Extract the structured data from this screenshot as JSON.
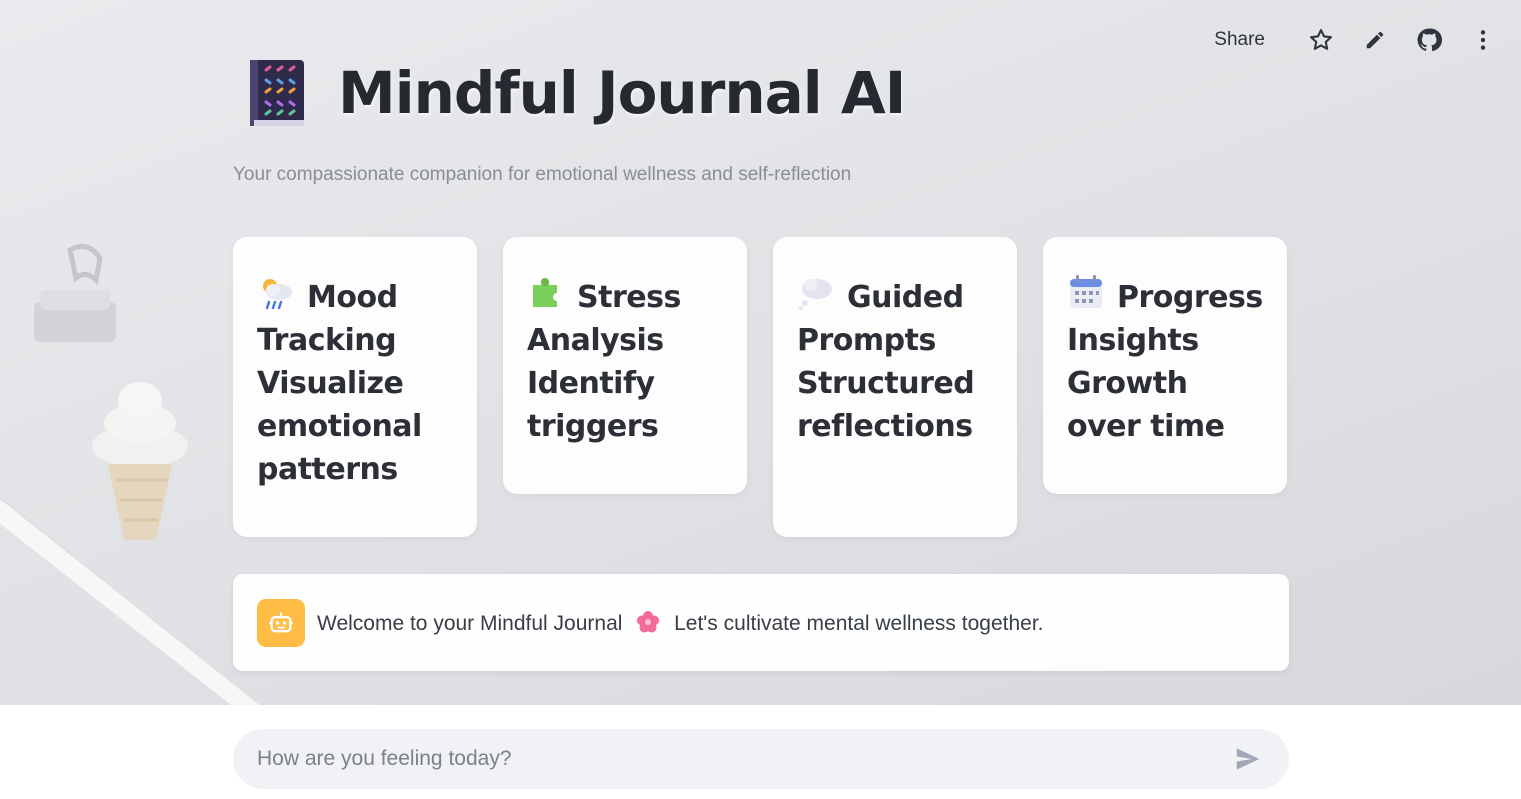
{
  "toolbar": {
    "share_label": "Share",
    "icons": [
      "star-icon",
      "pencil-icon",
      "github-icon",
      "more-vertical-icon"
    ]
  },
  "header": {
    "title": "Mindful Journal AI",
    "title_icon": "notebook-icon",
    "subtitle": "Your compassionate companion for emotional wellness and self-reflection"
  },
  "features": [
    {
      "icon": "rain-cloud-icon",
      "text": "Mood Tracking Visualize emotional patterns"
    },
    {
      "icon": "puzzle-piece-icon",
      "text": "Stress Analysis Identify triggers"
    },
    {
      "icon": "thought-bubble-icon",
      "text": "Guided Prompts Structured reflections"
    },
    {
      "icon": "calendar-icon",
      "text": "Progress Insights Growth over time"
    }
  ],
  "chat": {
    "message": {
      "avatar": "robot-icon",
      "text_before": "Welcome to your Mindful Journal",
      "emoji": "cherry-blossom-icon",
      "text_after": "Let's cultivate mental wellness together."
    },
    "input_placeholder": "How are you feeling today?",
    "send_icon": "send-icon"
  },
  "colors": {
    "avatar_bg": "#ffbd45",
    "input_bg": "#f0f2f6",
    "title_color": "#262a30",
    "subtitle_color": "#8a8d94"
  }
}
